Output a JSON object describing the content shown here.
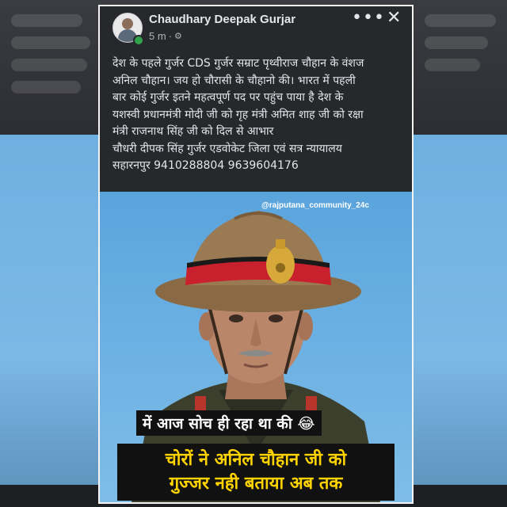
{
  "post": {
    "author": "Chaudhary Deepak Gurjar",
    "time": "5 m",
    "privacy_icon": "gear-icon",
    "more_icon": "•••",
    "close_icon": "✕",
    "text_lines": [
      "देश के पहले गुर्जर CDS गुर्जर सम्राट पृथ्वीराज चौहान के वंशज",
      "अनिल चौहान। जय हो चौरासी के चौहानो की। भारत में पहली",
      "बार कोई गुर्जर इतने महत्वपूर्ण पद पर पहुंच पाया है देश के",
      "यशस्वी प्रधानमंत्री मोदी जी को गृह मंत्री अमित शाह जी को रक्षा",
      "मंत्री राजनाथ सिंह जी को दिल से आभार",
      "चौधरी दीपक सिंह गुर्जर एडवोकेट जिला एवं सत्र न्यायालय",
      "सहारनपुर 9410288804 9639604176"
    ]
  },
  "image": {
    "watermark": "@rajputana_community_24c",
    "caption_line1": "में आज सोच ही रहा था की 😂",
    "caption_line2": "चोरों ने अनिल चौहान जी को",
    "caption_line3": "गुज्जर नही बताया अब तक"
  },
  "colors": {
    "card_bg": "#26282c",
    "text": "#e4e6eb",
    "subtext": "#b0b3b8",
    "online": "#31a24c",
    "caption_yellow": "#ffd400",
    "sky": "#6cb1e3"
  }
}
